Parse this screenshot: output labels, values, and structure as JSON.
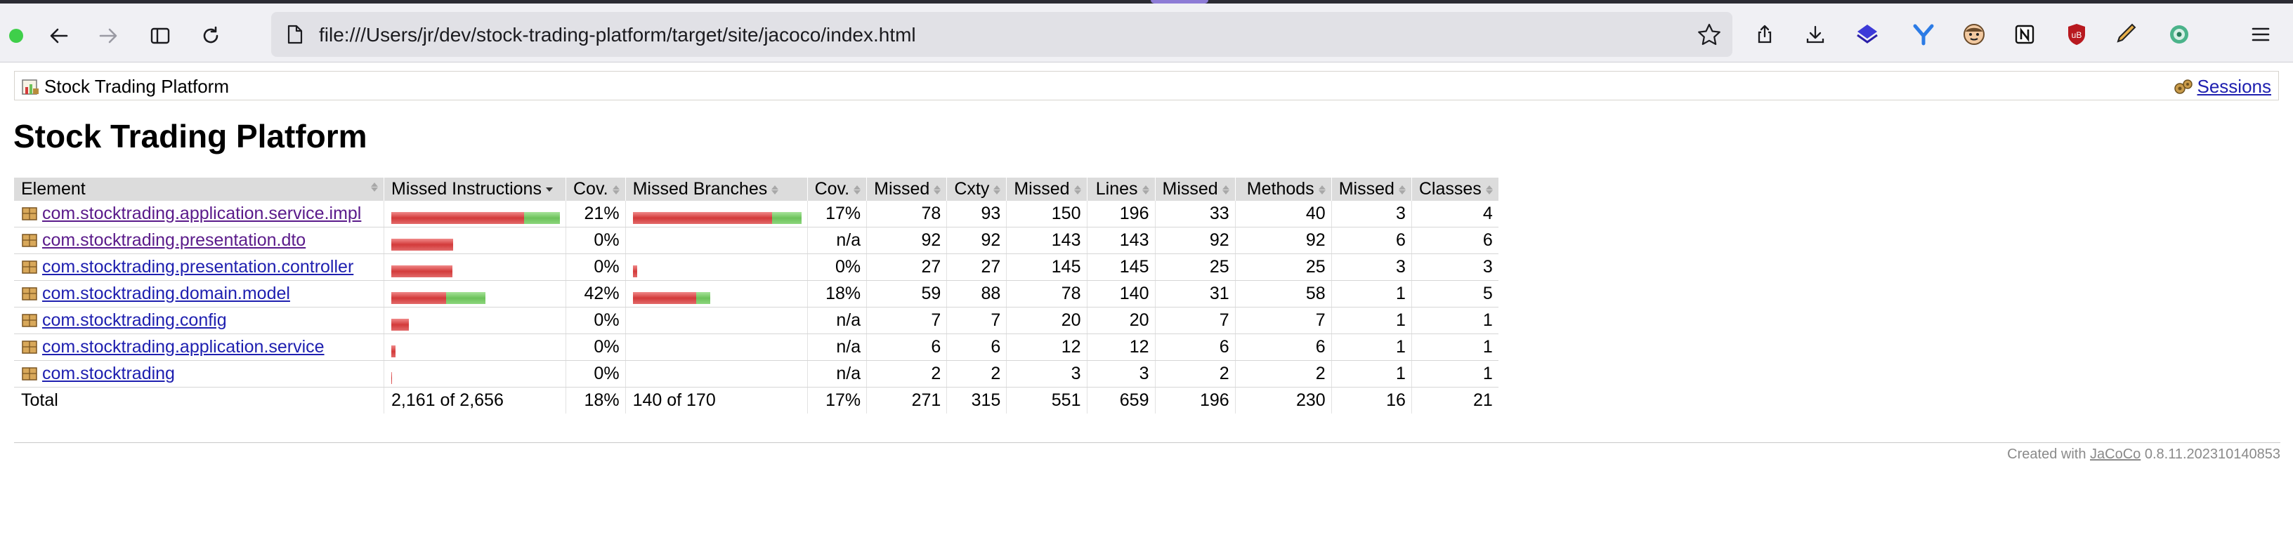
{
  "browser": {
    "url": "file:///Users/jr/dev/stock-trading-platform/target/site/jacoco/index.html",
    "extensions": [
      "layers-icon",
      "y-icon",
      "face-icon",
      "notion-icon",
      "ublock-icon",
      "pen-icon",
      "orb-icon"
    ]
  },
  "breadcrumb": {
    "title": "Stock Trading Platform",
    "sessions_label": "Sessions"
  },
  "page_title": "Stock Trading Platform",
  "table": {
    "headers": {
      "element": "Element",
      "missed_instructions": "Missed Instructions",
      "cov1": "Cov.",
      "missed_branches": "Missed Branches",
      "cov2": "Cov.",
      "missed_cxty": "Missed",
      "cxty": "Cxty",
      "missed_lines": "Missed",
      "lines": "Lines",
      "missed_methods": "Missed",
      "methods": "Methods",
      "missed_classes": "Missed",
      "classes": "Classes"
    },
    "rows": [
      {
        "name": "com.stocktrading.application.service.impl",
        "visited": true,
        "instr_missed": 1166,
        "instr_covered": 316,
        "instr_cov": "21%",
        "br_missed": 140,
        "br_covered": 30,
        "br_cov": "17%",
        "cxty_missed": "78",
        "cxty": "93",
        "lines_missed": "150",
        "lines": "196",
        "methods_missed": "33",
        "methods": "40",
        "classes_missed": "3",
        "classes": "4"
      },
      {
        "name": "com.stocktrading.presentation.dto",
        "visited": true,
        "instr_missed": 541,
        "instr_covered": 0,
        "instr_cov": "0%",
        "br_missed": 0,
        "br_covered": 0,
        "br_cov": "n/a",
        "cxty_missed": "92",
        "cxty": "92",
        "lines_missed": "143",
        "lines": "143",
        "methods_missed": "92",
        "methods": "92",
        "classes_missed": "6",
        "classes": "6"
      },
      {
        "name": "com.stocktrading.presentation.controller",
        "visited": false,
        "instr_missed": 535,
        "instr_covered": 0,
        "instr_cov": "0%",
        "br_missed": 4,
        "br_covered": 0,
        "br_cov": "0%",
        "cxty_missed": "27",
        "cxty": "27",
        "lines_missed": "145",
        "lines": "145",
        "methods_missed": "25",
        "methods": "25",
        "classes_missed": "3",
        "classes": "3"
      },
      {
        "name": "com.stocktrading.domain.model",
        "visited": false,
        "instr_missed": 479,
        "instr_covered": 343,
        "instr_cov": "42%",
        "br_missed": 64,
        "br_covered": 14,
        "br_cov": "18%",
        "cxty_missed": "59",
        "cxty": "88",
        "lines_missed": "78",
        "lines": "140",
        "methods_missed": "31",
        "methods": "58",
        "classes_missed": "1",
        "classes": "5"
      },
      {
        "name": "com.stocktrading.config",
        "visited": false,
        "instr_missed": 154,
        "instr_covered": 0,
        "instr_cov": "0%",
        "br_missed": 0,
        "br_covered": 0,
        "br_cov": "n/a",
        "cxty_missed": "7",
        "cxty": "7",
        "lines_missed": "20",
        "lines": "20",
        "methods_missed": "7",
        "methods": "7",
        "classes_missed": "1",
        "classes": "1"
      },
      {
        "name": "com.stocktrading.application.service",
        "visited": false,
        "instr_missed": 36,
        "instr_covered": 0,
        "instr_cov": "0%",
        "br_missed": 0,
        "br_covered": 0,
        "br_cov": "n/a",
        "cxty_missed": "6",
        "cxty": "6",
        "lines_missed": "12",
        "lines": "12",
        "methods_missed": "6",
        "methods": "6",
        "classes_missed": "1",
        "classes": "1"
      },
      {
        "name": "com.stocktrading",
        "visited": false,
        "instr_missed": 8,
        "instr_covered": 0,
        "instr_cov": "0%",
        "br_missed": 0,
        "br_covered": 0,
        "br_cov": "n/a",
        "cxty_missed": "2",
        "cxty": "2",
        "lines_missed": "3",
        "lines": "3",
        "methods_missed": "2",
        "methods": "2",
        "classes_missed": "1",
        "classes": "1"
      }
    ],
    "total": {
      "label": "Total",
      "instr": "2,161 of 2,656",
      "instr_cov": "18%",
      "br": "140 of 170",
      "br_cov": "17%",
      "cxty_missed": "271",
      "cxty": "315",
      "lines_missed": "551",
      "lines": "659",
      "methods_missed": "196",
      "methods": "230",
      "classes_missed": "16",
      "classes": "21"
    }
  },
  "footer": {
    "prefix": "Created with",
    "link": "JaCoCo",
    "version": "0.8.11.202310140853"
  },
  "colors": {
    "missed": "#d33a3a",
    "covered": "#6cc25a",
    "link": "#1f20b0"
  }
}
